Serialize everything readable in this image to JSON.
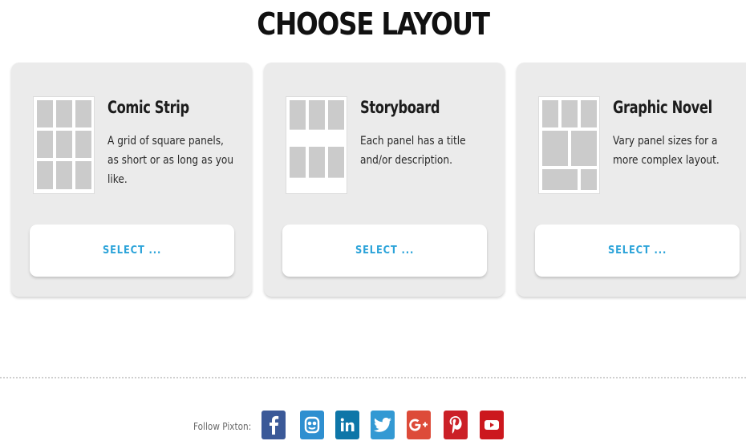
{
  "page": {
    "title": "CHOOSE LAYOUT"
  },
  "layouts": [
    {
      "title": "Comic Strip",
      "description": "A grid of square panels, as short or as long as you like.",
      "button_label": "SELECT ...",
      "thumbnail_icon": "comic-strip-grid-icon"
    },
    {
      "title": "Storyboard",
      "description": "Each panel has a title and/or description.",
      "button_label": "SELECT ...",
      "thumbnail_icon": "storyboard-icon"
    },
    {
      "title": "Graphic Novel",
      "description": "Vary panel sizes for a more complex layout.",
      "button_label": "SELECT ...",
      "thumbnail_icon": "graphic-novel-icon"
    }
  ],
  "footer": {
    "follow_label": "Follow Pixton:",
    "social": [
      {
        "name": "facebook",
        "glyph": "f",
        "color": "#3b5998"
      },
      {
        "name": "edmodo",
        "glyph": "edmodo",
        "color": "#2e8fd0"
      },
      {
        "name": "linkedin",
        "glyph": "in",
        "color": "#0e76a8"
      },
      {
        "name": "twitter",
        "glyph": "twitter",
        "color": "#3399d3"
      },
      {
        "name": "google-plus",
        "glyph": "8+",
        "color": "#dd4b39"
      },
      {
        "name": "pinterest",
        "glyph": "p",
        "color": "#cb2027"
      },
      {
        "name": "youtube",
        "glyph": "play",
        "color": "#cc181e"
      }
    ]
  },
  "colors": {
    "accent": "#2ba3d9",
    "card_bg": "#ebebeb"
  }
}
